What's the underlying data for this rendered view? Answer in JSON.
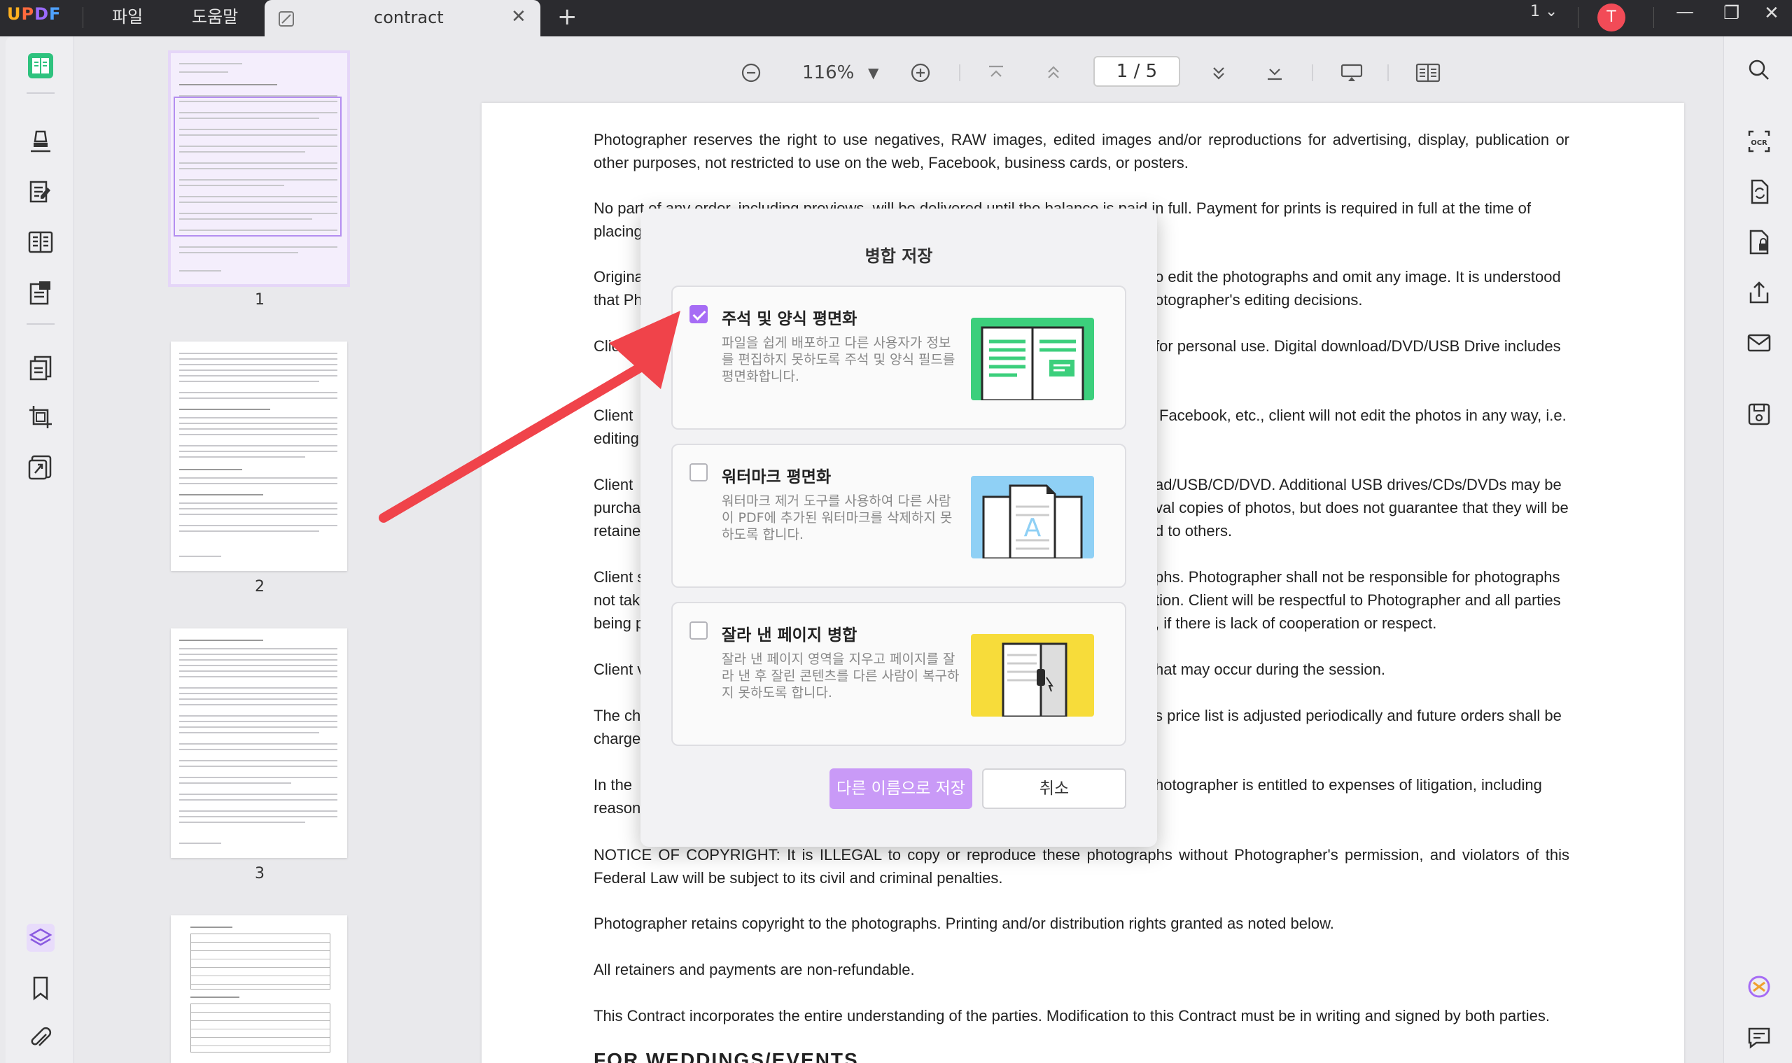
{
  "app": {
    "logo_letters": [
      "U",
      "P",
      "D",
      "F"
    ],
    "menu_file": "파일",
    "menu_help": "도움말",
    "tab_title": "contract",
    "page_counter": "1",
    "avatar_letter": "T"
  },
  "toolbar": {
    "zoom": "116%",
    "page_current": "1",
    "page_separator": "/",
    "page_total": "5"
  },
  "thumbnails": [
    {
      "number": "1"
    },
    {
      "number": "2"
    },
    {
      "number": "3"
    }
  ],
  "document": {
    "p1": "Photographer reserves the right to use negatives, RAW images, edited images and/or reproductions for advertising, display, publication or other purposes, not restricted to use on the web, Facebook, business cards, or posters.",
    "p2_left_1": "No part of any order, including previews, will be delivered until the balance is paid in full. Payment for prints is required in full at the time of",
    "p2_left_2": "placing",
    "p3_left_1": "Origina",
    "p3_right_1": "o edit the photographs and omit any image. It is understood",
    "p3_left_2": "that Ph",
    "p3_right_2": "otographer's editing decisions.",
    "p4_left_1": "Clien",
    "p4_right_1": "for personal use. Digital download/DVD/USB Drive includes",
    "p5_left_1": "Client",
    "p5_right_1": "Facebook, etc., client will not edit the photos in any way, i.e.",
    "p5_left_2": "editing",
    "p6_left_1": "Client",
    "p6_right_1": "ad/USB/CD/DVD. Additional USB drives/CDs/DVDs may be",
    "p6_left_2": "purcha",
    "p6_right_2": "val copies of photos, but does not guarantee that they will be",
    "p6_left_3": "retaine",
    "p6_right_3": "d to others.",
    "p7_left_1": "Client s",
    "p7_right_1": "phs. Photographer shall not be responsible for photographs",
    "p7_left_2": "not tak",
    "p7_right_2": "tion. Client will be respectful to Photographer and all parties",
    "p7_left_3": "being p",
    "p7_right_3": ", if there is lack of cooperation or respect.",
    "p8_left_1": "Client v",
    "p8_right_1": "hat may occur during the session.",
    "p9_left_1": "The ch",
    "p9_right_1": "s price list is adjusted periodically and future orders shall be",
    "p9_left_2": "charge",
    "p10_left_1": "In the",
    "p10_right_1": "hotographer is entitled to expenses of litigation, including",
    "p10_left_2": "reason",
    "p11": "NOTICE OF COPYRIGHT: It is ILLEGAL to copy or reproduce these photographs without Photographer's permission, and violators of this Federal Law will be subject to its civil and criminal penalties.",
    "p12": "Photographer retains copyright to the photographs. Printing and/or distribution rights granted as noted below.",
    "p13": "All retainers and payments are non-refundable.",
    "p14": "This Contract incorporates the entire understanding of the parties. Modification to this Contract must be in writing and signed by both parties.",
    "p15": "FOR WEDDINGS/EVENTS"
  },
  "modal": {
    "title": "병합 저장",
    "options": [
      {
        "title": "주석 및 양식 평면화",
        "description": "파일을 쉽게 배포하고 다른 사용자가 정보를 편집하지 못하도록 주석 및 양식 필드를 평면화합니다.",
        "checked": true,
        "illustration_color": "#3ccf7c"
      },
      {
        "title": "워터마크 평면화",
        "description": "워터마크 제거 도구를 사용하여 다른 사람이 PDF에 추가된 워터마크를 삭제하지 못하도록 합니다.",
        "checked": false,
        "illustration_color": "#8fd0f5"
      },
      {
        "title": "잘라 낸 페이지 병합",
        "description": "잘라 낸 페이지 영역을 지우고 페이지를 잘라 낸 후 잘린 콘텐츠를 다른 사람이 복구하지 못하도록 합니다.",
        "checked": false,
        "illustration_color": "#f7dc3a"
      }
    ],
    "save_as_label": "다른 이름으로 저장",
    "cancel_label": "취소"
  },
  "colors": {
    "accent": "#a66cf5",
    "save_button": "#c99af7",
    "arrow": "#f0434a",
    "titlebar": "#2b2b2f"
  }
}
